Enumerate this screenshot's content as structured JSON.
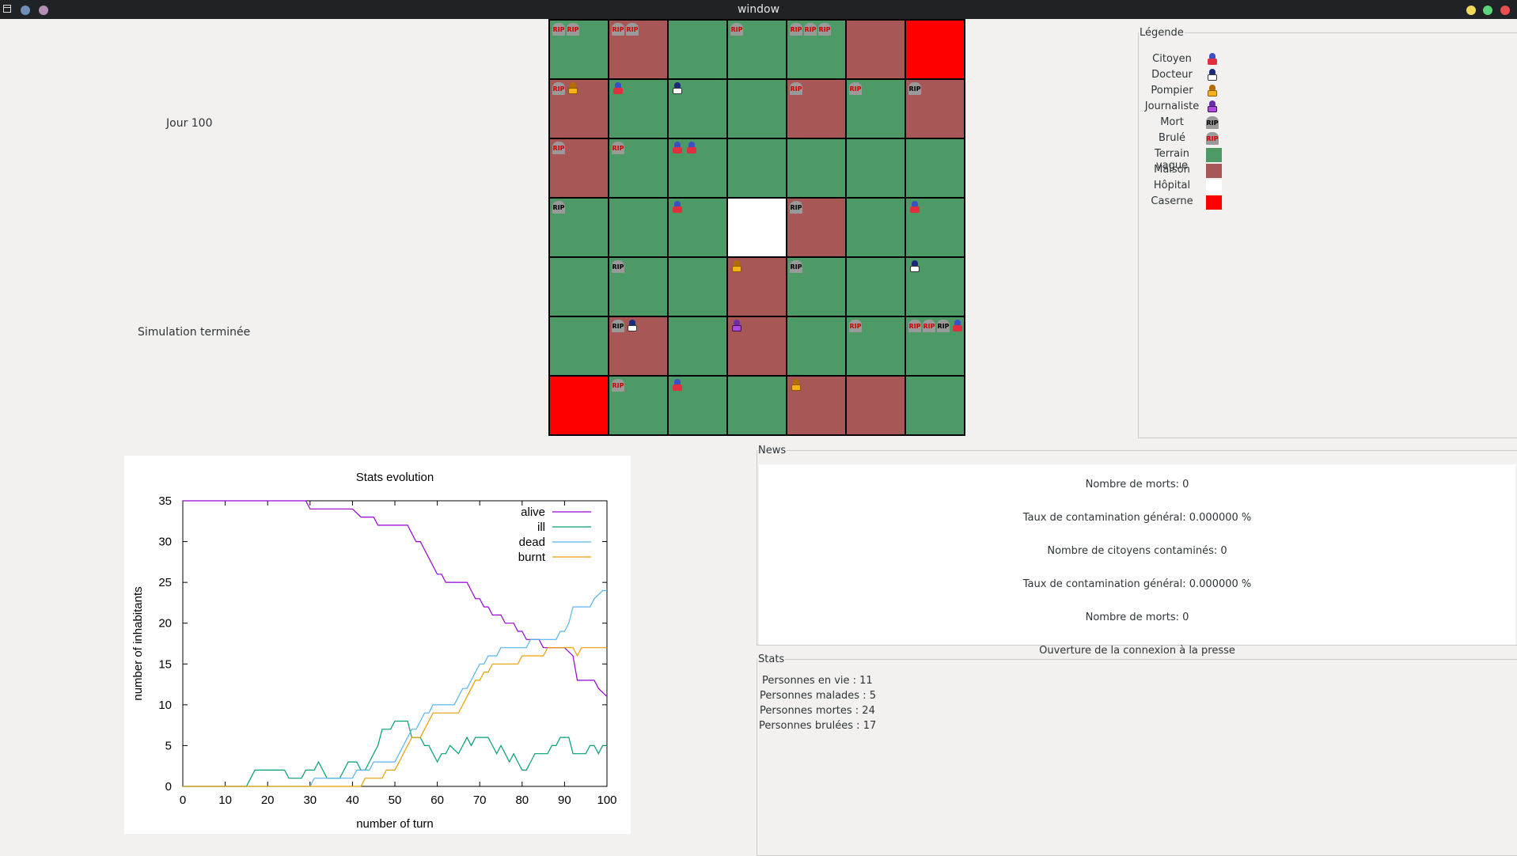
{
  "window": {
    "title": "window"
  },
  "day_label": "Jour 100",
  "status_label": "Simulation terminée",
  "grid": [
    [
      {
        "type": "terrain",
        "tokens": [
          "brule",
          "brule"
        ]
      },
      {
        "type": "maison",
        "tokens": [
          "brule",
          "brule"
        ]
      },
      {
        "type": "terrain",
        "tokens": []
      },
      {
        "type": "terrain",
        "tokens": [
          "brule"
        ]
      },
      {
        "type": "terrain",
        "tokens": [
          "brule",
          "brule",
          "brule"
        ]
      },
      {
        "type": "maison",
        "tokens": []
      },
      {
        "type": "caserne",
        "tokens": []
      }
    ],
    [
      {
        "type": "maison",
        "tokens": [
          "brule",
          "pompier"
        ]
      },
      {
        "type": "terrain",
        "tokens": [
          "citoyen"
        ]
      },
      {
        "type": "terrain",
        "tokens": [
          "docteur"
        ]
      },
      {
        "type": "terrain",
        "tokens": []
      },
      {
        "type": "maison",
        "tokens": [
          "brule"
        ]
      },
      {
        "type": "terrain",
        "tokens": [
          "brule"
        ]
      },
      {
        "type": "maison",
        "tokens": [
          "mort"
        ]
      }
    ],
    [
      {
        "type": "maison",
        "tokens": [
          "brule"
        ]
      },
      {
        "type": "terrain",
        "tokens": [
          "brule"
        ]
      },
      {
        "type": "terrain",
        "tokens": [
          "citoyen",
          "citoyen"
        ]
      },
      {
        "type": "terrain",
        "tokens": []
      },
      {
        "type": "terrain",
        "tokens": []
      },
      {
        "type": "terrain",
        "tokens": []
      },
      {
        "type": "terrain",
        "tokens": []
      }
    ],
    [
      {
        "type": "terrain",
        "tokens": [
          "mort"
        ]
      },
      {
        "type": "terrain",
        "tokens": []
      },
      {
        "type": "terrain",
        "tokens": [
          "citoyen"
        ]
      },
      {
        "type": "hopital",
        "tokens": []
      },
      {
        "type": "maison",
        "tokens": [
          "mort"
        ]
      },
      {
        "type": "terrain",
        "tokens": []
      },
      {
        "type": "terrain",
        "tokens": [
          "citoyen"
        ]
      }
    ],
    [
      {
        "type": "terrain",
        "tokens": []
      },
      {
        "type": "terrain",
        "tokens": [
          "mort"
        ]
      },
      {
        "type": "terrain",
        "tokens": []
      },
      {
        "type": "maison",
        "tokens": [
          "pompier"
        ]
      },
      {
        "type": "terrain",
        "tokens": [
          "mort"
        ]
      },
      {
        "type": "terrain",
        "tokens": []
      },
      {
        "type": "terrain",
        "tokens": [
          "docteur"
        ]
      }
    ],
    [
      {
        "type": "terrain",
        "tokens": []
      },
      {
        "type": "maison",
        "tokens": [
          "mort",
          "docteur"
        ]
      },
      {
        "type": "terrain",
        "tokens": []
      },
      {
        "type": "maison",
        "tokens": [
          "journaliste"
        ]
      },
      {
        "type": "terrain",
        "tokens": []
      },
      {
        "type": "terrain",
        "tokens": [
          "brule"
        ]
      },
      {
        "type": "terrain",
        "tokens": [
          "brule",
          "brule",
          "mort",
          "citoyen"
        ]
      }
    ],
    [
      {
        "type": "caserne",
        "tokens": []
      },
      {
        "type": "terrain",
        "tokens": [
          "brule"
        ]
      },
      {
        "type": "terrain",
        "tokens": [
          "citoyen"
        ]
      },
      {
        "type": "terrain",
        "tokens": []
      },
      {
        "type": "maison",
        "tokens": [
          "pompier"
        ]
      },
      {
        "type": "maison",
        "tokens": []
      },
      {
        "type": "terrain",
        "tokens": []
      }
    ]
  ],
  "rip_text": "RIP",
  "legend": {
    "title": "Légende",
    "items": [
      {
        "label": "Citoyen",
        "kind": "citoyen"
      },
      {
        "label": "Docteur",
        "kind": "docteur"
      },
      {
        "label": "Pompier",
        "kind": "pompier"
      },
      {
        "label": "Journaliste",
        "kind": "journaliste"
      },
      {
        "label": "Mort",
        "kind": "mort"
      },
      {
        "label": "Brulé",
        "kind": "brule"
      },
      {
        "label": "Terrain vague",
        "kind": "swatch",
        "color": "#4e9a66"
      },
      {
        "label": "Maison",
        "kind": "swatch",
        "color": "#a85757"
      },
      {
        "label": "Hôpital",
        "kind": "swatch",
        "color": "#ffffff"
      },
      {
        "label": "Caserne",
        "kind": "swatch",
        "color": "#ff0000"
      }
    ]
  },
  "news": {
    "title": "News",
    "lines": [
      "Nombre de morts: 0",
      "Taux de contamination général: 0.000000 %",
      "Nombre de citoyens contaminés: 0",
      "Taux de contamination général: 0.000000 %",
      "Nombre de morts: 0",
      "Ouverture de la connexion à la presse"
    ]
  },
  "stats": {
    "title": "Stats",
    "lines": [
      "Personnes en vie : 11",
      "Personnes malades : 5",
      "Personnes mortes : 24",
      "Personnes brulées : 17"
    ]
  },
  "chart_data": {
    "type": "line",
    "title": "Stats evolution",
    "xlabel": "number of turn",
    "ylabel": "number of inhabitants",
    "xlim": [
      0,
      100
    ],
    "ylim": [
      0,
      35
    ],
    "xticks": [
      0,
      10,
      20,
      30,
      40,
      50,
      60,
      70,
      80,
      90,
      100
    ],
    "yticks": [
      0,
      5,
      10,
      15,
      20,
      25,
      30,
      35
    ],
    "legend_position": "top-right",
    "series": [
      {
        "name": "alive",
        "color": "#9400d3",
        "points": [
          [
            0,
            35
          ],
          [
            29,
            35
          ],
          [
            30,
            34
          ],
          [
            40,
            34
          ],
          [
            42,
            33
          ],
          [
            45,
            33
          ],
          [
            46,
            32
          ],
          [
            53,
            32
          ],
          [
            54,
            31
          ],
          [
            55,
            30
          ],
          [
            56,
            30
          ],
          [
            57,
            29
          ],
          [
            58,
            28
          ],
          [
            59,
            27
          ],
          [
            60,
            26
          ],
          [
            61,
            26
          ],
          [
            62,
            25
          ],
          [
            67,
            25
          ],
          [
            68,
            24
          ],
          [
            69,
            23
          ],
          [
            70,
            23
          ],
          [
            71,
            22
          ],
          [
            72,
            22
          ],
          [
            73,
            21
          ],
          [
            75,
            21
          ],
          [
            76,
            20
          ],
          [
            78,
            20
          ],
          [
            79,
            19
          ],
          [
            80,
            19
          ],
          [
            81,
            18
          ],
          [
            84,
            18
          ],
          [
            85,
            17
          ],
          [
            90,
            17
          ],
          [
            92,
            16
          ],
          [
            93,
            13
          ],
          [
            97,
            13
          ],
          [
            98,
            12
          ],
          [
            100,
            11
          ]
        ]
      },
      {
        "name": "ill",
        "color": "#009e73",
        "points": [
          [
            0,
            0
          ],
          [
            15,
            0
          ],
          [
            16,
            1
          ],
          [
            17,
            2
          ],
          [
            24,
            2
          ],
          [
            25,
            1
          ],
          [
            28,
            1
          ],
          [
            29,
            2
          ],
          [
            31,
            2
          ],
          [
            32,
            3
          ],
          [
            33,
            2
          ],
          [
            34,
            1
          ],
          [
            37,
            1
          ],
          [
            38,
            2
          ],
          [
            39,
            3
          ],
          [
            41,
            3
          ],
          [
            42,
            2
          ],
          [
            43,
            2
          ],
          [
            44,
            3
          ],
          [
            45,
            4
          ],
          [
            46,
            5
          ],
          [
            47,
            7
          ],
          [
            48,
            7
          ],
          [
            49,
            7
          ],
          [
            50,
            8
          ],
          [
            53,
            8
          ],
          [
            54,
            6
          ],
          [
            56,
            6
          ],
          [
            57,
            5
          ],
          [
            58,
            5
          ],
          [
            59,
            4
          ],
          [
            60,
            3
          ],
          [
            61,
            4
          ],
          [
            62,
            4
          ],
          [
            63,
            5
          ],
          [
            65,
            4
          ],
          [
            66,
            5
          ],
          [
            67,
            6
          ],
          [
            68,
            5
          ],
          [
            69,
            6
          ],
          [
            72,
            6
          ],
          [
            73,
            5
          ],
          [
            74,
            4
          ],
          [
            75,
            5
          ],
          [
            76,
            4
          ],
          [
            77,
            3
          ],
          [
            78,
            4
          ],
          [
            79,
            3
          ],
          [
            80,
            2
          ],
          [
            81,
            2
          ],
          [
            82,
            3
          ],
          [
            83,
            4
          ],
          [
            86,
            4
          ],
          [
            87,
            5
          ],
          [
            88,
            5
          ],
          [
            89,
            6
          ],
          [
            91,
            6
          ],
          [
            92,
            4
          ],
          [
            95,
            4
          ],
          [
            96,
            5
          ],
          [
            97,
            5
          ],
          [
            98,
            4
          ],
          [
            99,
            5
          ],
          [
            100,
            5
          ]
        ]
      },
      {
        "name": "dead",
        "color": "#56b4e9",
        "points": [
          [
            0,
            0
          ],
          [
            30,
            0
          ],
          [
            31,
            1
          ],
          [
            40,
            1
          ],
          [
            41,
            2
          ],
          [
            44,
            2
          ],
          [
            45,
            3
          ],
          [
            49,
            3
          ],
          [
            50,
            3
          ],
          [
            51,
            4
          ],
          [
            52,
            5
          ],
          [
            53,
            6
          ],
          [
            54,
            7
          ],
          [
            55,
            7
          ],
          [
            56,
            8
          ],
          [
            57,
            9
          ],
          [
            58,
            9
          ],
          [
            59,
            10
          ],
          [
            64,
            10
          ],
          [
            65,
            11
          ],
          [
            66,
            12
          ],
          [
            67,
            12
          ],
          [
            68,
            13
          ],
          [
            69,
            14
          ],
          [
            70,
            15
          ],
          [
            71,
            15
          ],
          [
            72,
            16
          ],
          [
            74,
            16
          ],
          [
            75,
            17
          ],
          [
            81,
            17
          ],
          [
            82,
            18
          ],
          [
            88,
            18
          ],
          [
            89,
            19
          ],
          [
            90,
            19
          ],
          [
            91,
            20
          ],
          [
            92,
            22
          ],
          [
            96,
            22
          ],
          [
            97,
            23
          ],
          [
            99,
            24
          ],
          [
            100,
            24
          ]
        ]
      },
      {
        "name": "burnt",
        "color": "#e69f00",
        "points": [
          [
            0,
            0
          ],
          [
            42,
            0
          ],
          [
            43,
            1
          ],
          [
            47,
            1
          ],
          [
            48,
            2
          ],
          [
            50,
            2
          ],
          [
            51,
            3
          ],
          [
            52,
            4
          ],
          [
            53,
            5
          ],
          [
            54,
            6
          ],
          [
            56,
            6
          ],
          [
            57,
            7
          ],
          [
            58,
            8
          ],
          [
            59,
            9
          ],
          [
            65,
            9
          ],
          [
            66,
            10
          ],
          [
            67,
            11
          ],
          [
            68,
            12
          ],
          [
            69,
            13
          ],
          [
            70,
            13
          ],
          [
            71,
            14
          ],
          [
            72,
            14
          ],
          [
            73,
            15
          ],
          [
            79,
            15
          ],
          [
            80,
            16
          ],
          [
            85,
            16
          ],
          [
            86,
            17
          ],
          [
            92,
            17
          ],
          [
            93,
            16
          ],
          [
            94,
            17
          ],
          [
            100,
            17
          ]
        ]
      }
    ]
  }
}
